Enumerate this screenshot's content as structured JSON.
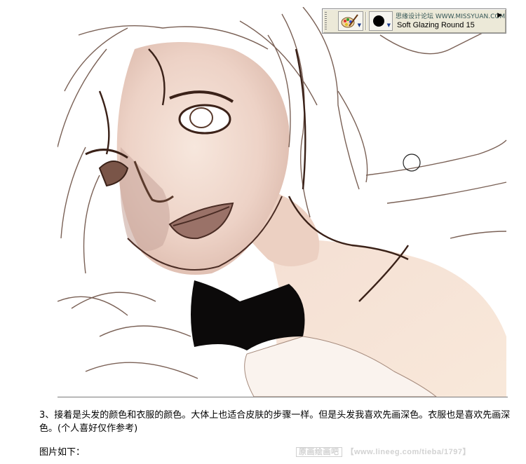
{
  "toolbar": {
    "watermark": "思缘设计论坛 WWW.MISSYUAN.COM",
    "variant_name": "Soft Glazing Round 15",
    "variant_icon": "paintbrush-palette-icon",
    "dab_icon": "round-dab-icon",
    "menu_icon": "menu-triangle-icon"
  },
  "artwork": {
    "description_icon": "painting-canvas"
  },
  "caption": {
    "text": "3、接着是头发的颜色和衣服的颜色。大体上也适合皮肤的步骤一样。但是头发我喜欢先画深色。衣服也是喜欢先画深色。(个人喜好仅作参考)"
  },
  "subcaption": {
    "text": "图片如下："
  },
  "footer": {
    "badge": "原画绘画吧",
    "url": "【www.lineeg.com/tieba/1797】"
  },
  "colors": {
    "toolbar_bg": "#ece9d8",
    "skin": "#f1d9cf",
    "line": "#5a3a2c",
    "bow": "#0c0a0a"
  }
}
